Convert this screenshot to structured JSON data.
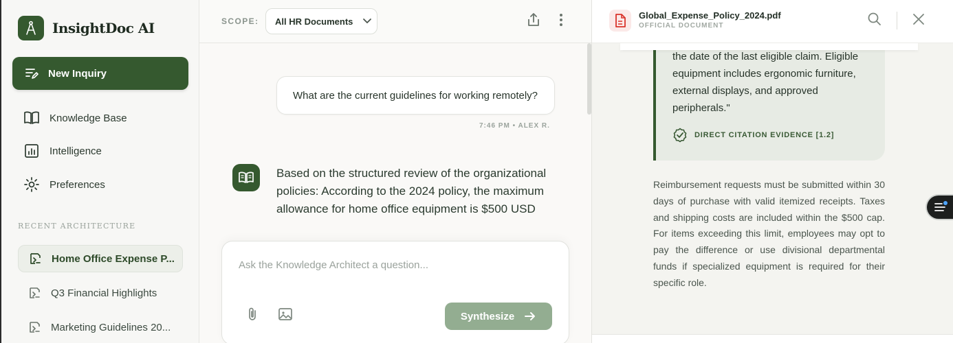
{
  "brand": {
    "name": "InsightDoc AI"
  },
  "sidebar": {
    "new_inquiry_label": "New Inquiry",
    "nav": [
      {
        "label": "Knowledge Base",
        "icon": "book-open-icon"
      },
      {
        "label": "Intelligence",
        "icon": "chart-icon"
      },
      {
        "label": "Preferences",
        "icon": "gear-icon"
      }
    ],
    "recent_label": "RECENT ARCHITECTURE",
    "recent": [
      {
        "label": "Home Office Expense P...",
        "active": true
      },
      {
        "label": "Q3 Financial Highlights",
        "active": false
      },
      {
        "label": "Marketing Guidelines 20...",
        "active": false
      }
    ]
  },
  "chat": {
    "scope_label": "SCOPE:",
    "scope_value": "All HR Documents",
    "user_message": "What are the current guidelines for working remotely?",
    "user_meta": "7:46 PM • ALEX R.",
    "ai_message": "Based on the structured review of the organizational policies: According to the 2024 policy, the maximum allowance for home office equipment is $500 USD",
    "composer_placeholder": "Ask the Knowledge Architect a question...",
    "synthesize_label": "Synthesize"
  },
  "viewer": {
    "doc_name": "Global_Expense_Policy_2024.pdf",
    "doc_type": "OFFICIAL DOCUMENT",
    "quote": "the date of the last eligible claim. Eligible equipment includes ergonomic furniture, external displays, and approved peripherals.\"",
    "evidence_label": "DIRECT CITATION EVIDENCE [1.2]",
    "body": "Reimbursement requests must be submitted within 30 days of purchase with valid itemized receipts. Taxes and shipping costs are included within the $500 cap. For items exceeding this limit, employees may opt to pay the difference or use divisional departmental funds if specialized equipment is required for their specific role."
  },
  "colors": {
    "brand_green": "#35592f",
    "synth_button": "#93ad91",
    "pdf_red": "#d9332b"
  }
}
